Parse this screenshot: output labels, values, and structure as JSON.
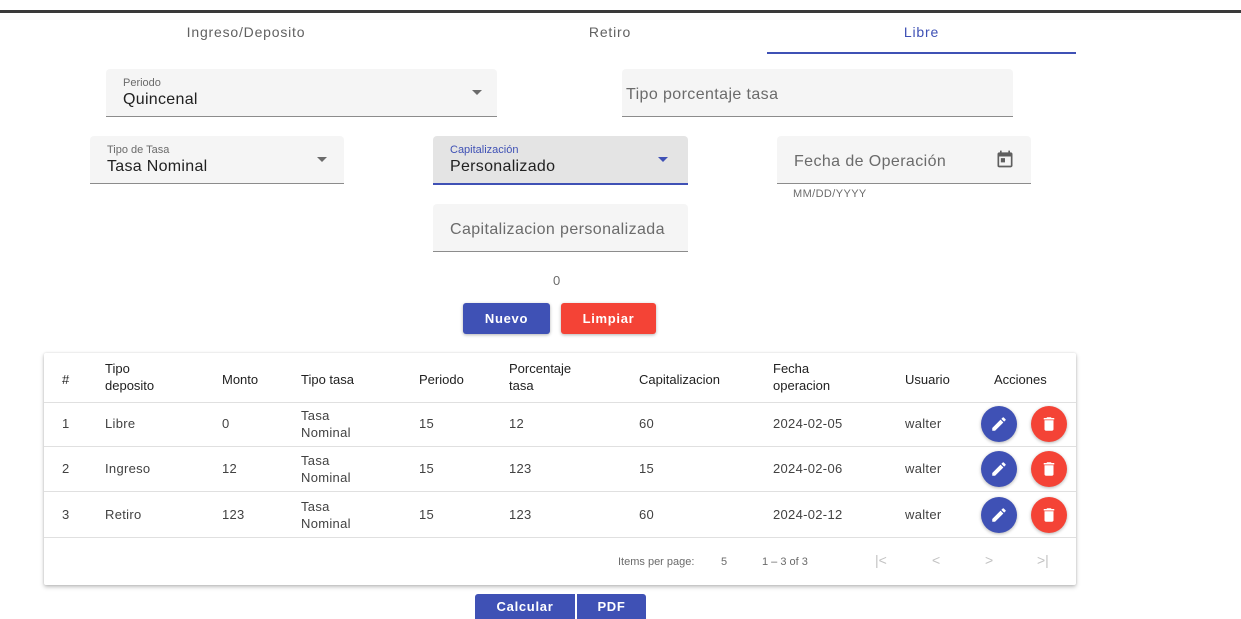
{
  "tabs": [
    {
      "label": "Ingreso/Deposito"
    },
    {
      "label": "Retiro"
    },
    {
      "label": "Libre"
    }
  ],
  "form": {
    "periodo": {
      "label": "Periodo",
      "value": "Quincenal"
    },
    "tipo_porcentaje_tasa": {
      "placeholder": "Tipo porcentaje tasa"
    },
    "tipo_tasa": {
      "label": "Tipo de Tasa",
      "value": "Tasa Nominal"
    },
    "capitalizacion": {
      "label": "Capitalización",
      "value": "Personalizado"
    },
    "fecha_operacion": {
      "placeholder": "Fecha de Operación",
      "hint": "MM/DD/YYYY"
    },
    "capitalizacion_personalizada": {
      "placeholder": "Capitalizacion personalizada"
    },
    "counter": "0"
  },
  "buttons": {
    "nuevo": "Nuevo",
    "limpiar": "Limpiar",
    "calcular": "Calcular",
    "pdf": "PDF"
  },
  "table": {
    "headers": {
      "num": "#",
      "tipo_deposito": [
        "Tipo",
        "deposito"
      ],
      "monto": "Monto",
      "tipo_tasa": "Tipo tasa",
      "periodo": "Periodo",
      "porcentaje_tasa": [
        "Porcentaje",
        "tasa"
      ],
      "capitalizacion": "Capitalizacion",
      "fecha_operacion": [
        "Fecha",
        "operacion"
      ],
      "usuario": "Usuario",
      "acciones": "Acciones"
    },
    "rows": [
      {
        "num": "1",
        "tipo": "Libre",
        "monto": "0",
        "tasa1": "Tasa",
        "tasa2": "Nominal",
        "periodo": "15",
        "porcentaje": "12",
        "capitalizacion": "60",
        "fecha": "2024-02-05",
        "usuario": "walter"
      },
      {
        "num": "2",
        "tipo": "Ingreso",
        "monto": "12",
        "tasa1": "Tasa",
        "tasa2": "Nominal",
        "periodo": "15",
        "porcentaje": "123",
        "capitalizacion": "15",
        "fecha": "2024-02-06",
        "usuario": "walter"
      },
      {
        "num": "3",
        "tipo": "Retiro",
        "monto": "123",
        "tasa1": "Tasa",
        "tasa2": "Nominal",
        "periodo": "15",
        "porcentaje": "123",
        "capitalizacion": "60",
        "fecha": "2024-02-12",
        "usuario": "walter"
      }
    ]
  },
  "paginator": {
    "items_per_page_label": "Items per page:",
    "items_per_page_value": "5",
    "range": "1 – 3 of 3"
  },
  "colors": {
    "primary": "#3f51b5",
    "warn": "#f44336"
  },
  "icons": [
    "calendar-icon",
    "dropdown-arrow-icon",
    "edit-icon",
    "delete-icon",
    "first-page-icon",
    "prev-page-icon",
    "next-page-icon",
    "last-page-icon"
  ]
}
